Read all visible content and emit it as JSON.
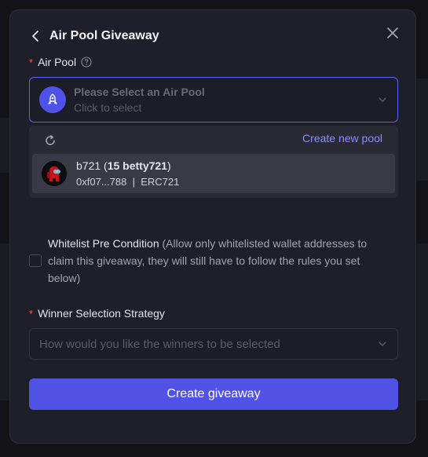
{
  "modal": {
    "title": "Air Pool Giveaway"
  },
  "air_pool": {
    "required_mark": "*",
    "label": "Air Pool",
    "select_title": "Please Select an Air Pool",
    "select_hint": "Click to select"
  },
  "dropdown": {
    "create_link": "Create new pool",
    "options": [
      {
        "name_prefix": "b721 (",
        "name_bold": "15 betty721",
        "name_suffix": ")",
        "address": "0xf07...788",
        "separator": "|",
        "standard": "ERC721"
      }
    ]
  },
  "whitelist": {
    "label": "Whitelist Pre Condition",
    "description": "(Allow only whitelisted wallet addresses to claim this giveaway, they will still have to follow the rules you set below)"
  },
  "winner": {
    "required_mark": "*",
    "label": "Winner Selection Strategy",
    "placeholder": "How would you like the winners to be selected"
  },
  "actions": {
    "create_button": "Create giveaway"
  },
  "colors": {
    "accent": "#5152e6",
    "link": "#8b8ef7",
    "required": "#ff4d4f"
  }
}
